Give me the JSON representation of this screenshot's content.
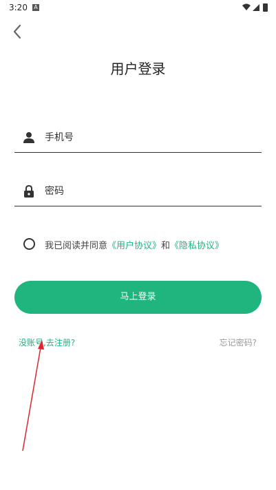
{
  "status_bar": {
    "time": "3:20",
    "notification_icon": "A"
  },
  "header": {
    "back_icon": "chevron-left",
    "title": "用户登录"
  },
  "form": {
    "phone": {
      "icon": "person-icon",
      "placeholder": "手机号"
    },
    "password": {
      "icon": "lock-icon",
      "placeholder": "密码"
    }
  },
  "agreement": {
    "checked": false,
    "prefix": "我已阅读并同意",
    "user_agreement": "《用户协议》",
    "conjunction": "和",
    "privacy_policy": "《隐私协议》"
  },
  "login_button": {
    "label": "马上登录"
  },
  "links": {
    "register": "没账号,去注册?",
    "forgot": "忘记密码?"
  },
  "colors": {
    "accent": "#20b57e",
    "annotation_arrow": "#e0242c"
  }
}
